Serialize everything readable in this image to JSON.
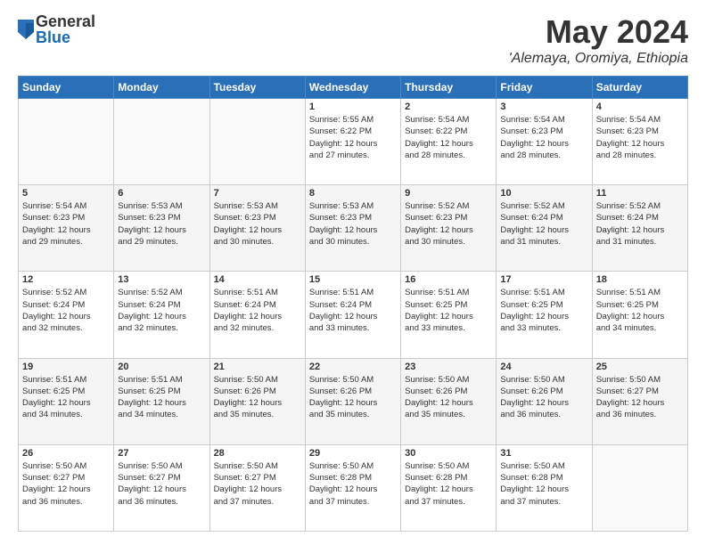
{
  "logo": {
    "general": "General",
    "blue": "Blue"
  },
  "title": {
    "month_year": "May 2024",
    "location": "'Alemaya, Oromiya, Ethiopia"
  },
  "header_days": [
    "Sunday",
    "Monday",
    "Tuesday",
    "Wednesday",
    "Thursday",
    "Friday",
    "Saturday"
  ],
  "weeks": [
    [
      {
        "day": "",
        "info": ""
      },
      {
        "day": "",
        "info": ""
      },
      {
        "day": "",
        "info": ""
      },
      {
        "day": "1",
        "info": "Sunrise: 5:55 AM\nSunset: 6:22 PM\nDaylight: 12 hours\nand 27 minutes."
      },
      {
        "day": "2",
        "info": "Sunrise: 5:54 AM\nSunset: 6:22 PM\nDaylight: 12 hours\nand 28 minutes."
      },
      {
        "day": "3",
        "info": "Sunrise: 5:54 AM\nSunset: 6:23 PM\nDaylight: 12 hours\nand 28 minutes."
      },
      {
        "day": "4",
        "info": "Sunrise: 5:54 AM\nSunset: 6:23 PM\nDaylight: 12 hours\nand 28 minutes."
      }
    ],
    [
      {
        "day": "5",
        "info": "Sunrise: 5:54 AM\nSunset: 6:23 PM\nDaylight: 12 hours\nand 29 minutes."
      },
      {
        "day": "6",
        "info": "Sunrise: 5:53 AM\nSunset: 6:23 PM\nDaylight: 12 hours\nand 29 minutes."
      },
      {
        "day": "7",
        "info": "Sunrise: 5:53 AM\nSunset: 6:23 PM\nDaylight: 12 hours\nand 30 minutes."
      },
      {
        "day": "8",
        "info": "Sunrise: 5:53 AM\nSunset: 6:23 PM\nDaylight: 12 hours\nand 30 minutes."
      },
      {
        "day": "9",
        "info": "Sunrise: 5:52 AM\nSunset: 6:23 PM\nDaylight: 12 hours\nand 30 minutes."
      },
      {
        "day": "10",
        "info": "Sunrise: 5:52 AM\nSunset: 6:24 PM\nDaylight: 12 hours\nand 31 minutes."
      },
      {
        "day": "11",
        "info": "Sunrise: 5:52 AM\nSunset: 6:24 PM\nDaylight: 12 hours\nand 31 minutes."
      }
    ],
    [
      {
        "day": "12",
        "info": "Sunrise: 5:52 AM\nSunset: 6:24 PM\nDaylight: 12 hours\nand 32 minutes."
      },
      {
        "day": "13",
        "info": "Sunrise: 5:52 AM\nSunset: 6:24 PM\nDaylight: 12 hours\nand 32 minutes."
      },
      {
        "day": "14",
        "info": "Sunrise: 5:51 AM\nSunset: 6:24 PM\nDaylight: 12 hours\nand 32 minutes."
      },
      {
        "day": "15",
        "info": "Sunrise: 5:51 AM\nSunset: 6:24 PM\nDaylight: 12 hours\nand 33 minutes."
      },
      {
        "day": "16",
        "info": "Sunrise: 5:51 AM\nSunset: 6:25 PM\nDaylight: 12 hours\nand 33 minutes."
      },
      {
        "day": "17",
        "info": "Sunrise: 5:51 AM\nSunset: 6:25 PM\nDaylight: 12 hours\nand 33 minutes."
      },
      {
        "day": "18",
        "info": "Sunrise: 5:51 AM\nSunset: 6:25 PM\nDaylight: 12 hours\nand 34 minutes."
      }
    ],
    [
      {
        "day": "19",
        "info": "Sunrise: 5:51 AM\nSunset: 6:25 PM\nDaylight: 12 hours\nand 34 minutes."
      },
      {
        "day": "20",
        "info": "Sunrise: 5:51 AM\nSunset: 6:25 PM\nDaylight: 12 hours\nand 34 minutes."
      },
      {
        "day": "21",
        "info": "Sunrise: 5:50 AM\nSunset: 6:26 PM\nDaylight: 12 hours\nand 35 minutes."
      },
      {
        "day": "22",
        "info": "Sunrise: 5:50 AM\nSunset: 6:26 PM\nDaylight: 12 hours\nand 35 minutes."
      },
      {
        "day": "23",
        "info": "Sunrise: 5:50 AM\nSunset: 6:26 PM\nDaylight: 12 hours\nand 35 minutes."
      },
      {
        "day": "24",
        "info": "Sunrise: 5:50 AM\nSunset: 6:26 PM\nDaylight: 12 hours\nand 36 minutes."
      },
      {
        "day": "25",
        "info": "Sunrise: 5:50 AM\nSunset: 6:27 PM\nDaylight: 12 hours\nand 36 minutes."
      }
    ],
    [
      {
        "day": "26",
        "info": "Sunrise: 5:50 AM\nSunset: 6:27 PM\nDaylight: 12 hours\nand 36 minutes."
      },
      {
        "day": "27",
        "info": "Sunrise: 5:50 AM\nSunset: 6:27 PM\nDaylight: 12 hours\nand 36 minutes."
      },
      {
        "day": "28",
        "info": "Sunrise: 5:50 AM\nSunset: 6:27 PM\nDaylight: 12 hours\nand 37 minutes."
      },
      {
        "day": "29",
        "info": "Sunrise: 5:50 AM\nSunset: 6:28 PM\nDaylight: 12 hours\nand 37 minutes."
      },
      {
        "day": "30",
        "info": "Sunrise: 5:50 AM\nSunset: 6:28 PM\nDaylight: 12 hours\nand 37 minutes."
      },
      {
        "day": "31",
        "info": "Sunrise: 5:50 AM\nSunset: 6:28 PM\nDaylight: 12 hours\nand 37 minutes."
      },
      {
        "day": "",
        "info": ""
      }
    ]
  ]
}
